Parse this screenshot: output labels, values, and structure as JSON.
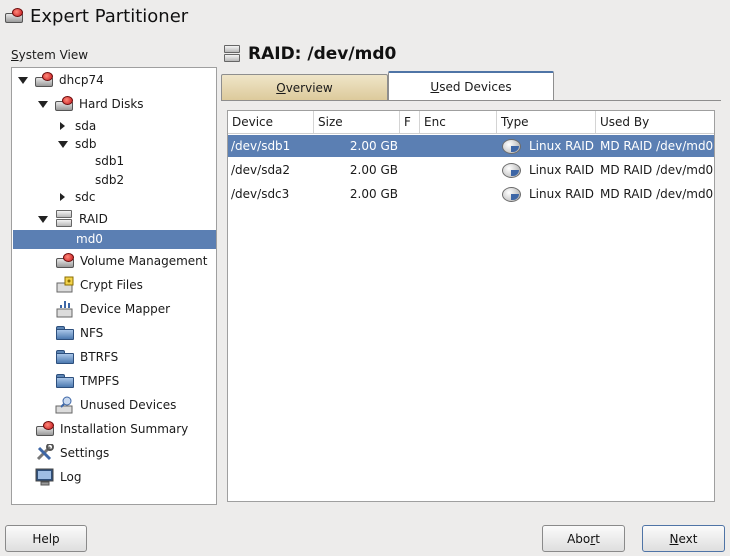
{
  "window": {
    "title": "Expert Partitioner"
  },
  "system_view": {
    "label_prefix": "S",
    "label_rest": "ystem View",
    "tree": {
      "host": "dhcp74",
      "hard_disks": "Hard Disks",
      "sda": "sda",
      "sdb": "sdb",
      "sdb1": "sdb1",
      "sdb2": "sdb2",
      "sdc": "sdc",
      "raid": "RAID",
      "md0": "md0",
      "volume_management": "Volume Management",
      "crypt_files": "Crypt Files",
      "device_mapper": "Device Mapper",
      "nfs": "NFS",
      "btrfs": "BTRFS",
      "tmpfs": "TMPFS",
      "unused_devices": "Unused Devices",
      "installation_summary": "Installation Summary",
      "settings": "Settings",
      "log": "Log"
    }
  },
  "header": {
    "title": "RAID: /dev/md0"
  },
  "tabs": [
    {
      "label_prefix": "O",
      "label_rest": "verview"
    },
    {
      "label_prefix": "U",
      "label_rest": "sed Devices"
    }
  ],
  "table": {
    "columns": [
      "Device",
      "Size",
      "F",
      "Enc",
      "Type",
      "Used By"
    ],
    "rows": [
      {
        "device": "/dev/sdb1",
        "size": "2.00 GB",
        "f": "",
        "enc": "",
        "type": "Linux RAID",
        "used_by": "MD RAID /dev/md0",
        "selected": true
      },
      {
        "device": "/dev/sda2",
        "size": "2.00 GB",
        "f": "",
        "enc": "",
        "type": "Linux RAID",
        "used_by": "MD RAID /dev/md0",
        "selected": false
      },
      {
        "device": "/dev/sdc3",
        "size": "2.00 GB",
        "f": "",
        "enc": "",
        "type": "Linux RAID",
        "used_by": "MD RAID /dev/md0",
        "selected": false
      }
    ]
  },
  "buttons": {
    "help": "Help",
    "abort_prefix": "Abo",
    "abort_u": "r",
    "abort_rest": "t",
    "next_u": "N",
    "next_rest": "ext"
  },
  "colors": {
    "selection": "#5b7fb3",
    "window_bg": "#edeceb",
    "tab_inactive": "#dcc99a",
    "tab_active_accent": "#4f74a6"
  },
  "icons": {
    "app": "hard-disk-red-icon",
    "raid": "raid-icon",
    "folder": "folder-icon",
    "disk": "partition-disk-icon"
  }
}
